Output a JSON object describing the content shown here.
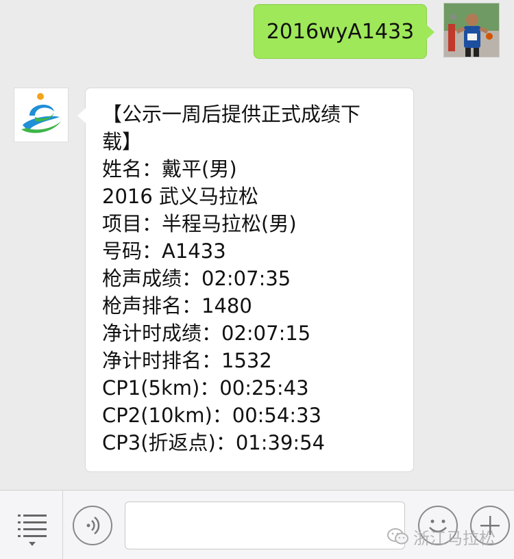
{
  "chat": {
    "sent_message": "2016wyA1433",
    "received_message": {
      "lines": [
        "【公示一周后提供正式成绩下",
        "载】",
        "姓名：戴平(男)",
        "2016 武义马拉松",
        "项目：半程马拉松(男)",
        "号码：A1433",
        "枪声成绩：02:07:35",
        "枪声排名：1480",
        "净计时成绩：02:07:15",
        "净计时排名：1532",
        "CP1(5km)：00:25:43",
        "CP2(10km)：00:54:33",
        "CP3(折返点)：01:39:54"
      ]
    }
  },
  "input_bar": {
    "icons": {
      "menu": "menu-list-icon",
      "voice": "voice-icon",
      "emoji": "smiley-icon",
      "more": "plus-icon"
    },
    "text_value": ""
  },
  "watermark": {
    "text": "浙江马拉松",
    "icon": "wechat-icon"
  },
  "colors": {
    "background": "#ebebeb",
    "sent_bubble": "#9fe85a",
    "received_bubble": "#ffffff",
    "logo_blue": "#1f8fd6",
    "logo_green": "#3db54a",
    "logo_orange": "#f5a31a"
  }
}
